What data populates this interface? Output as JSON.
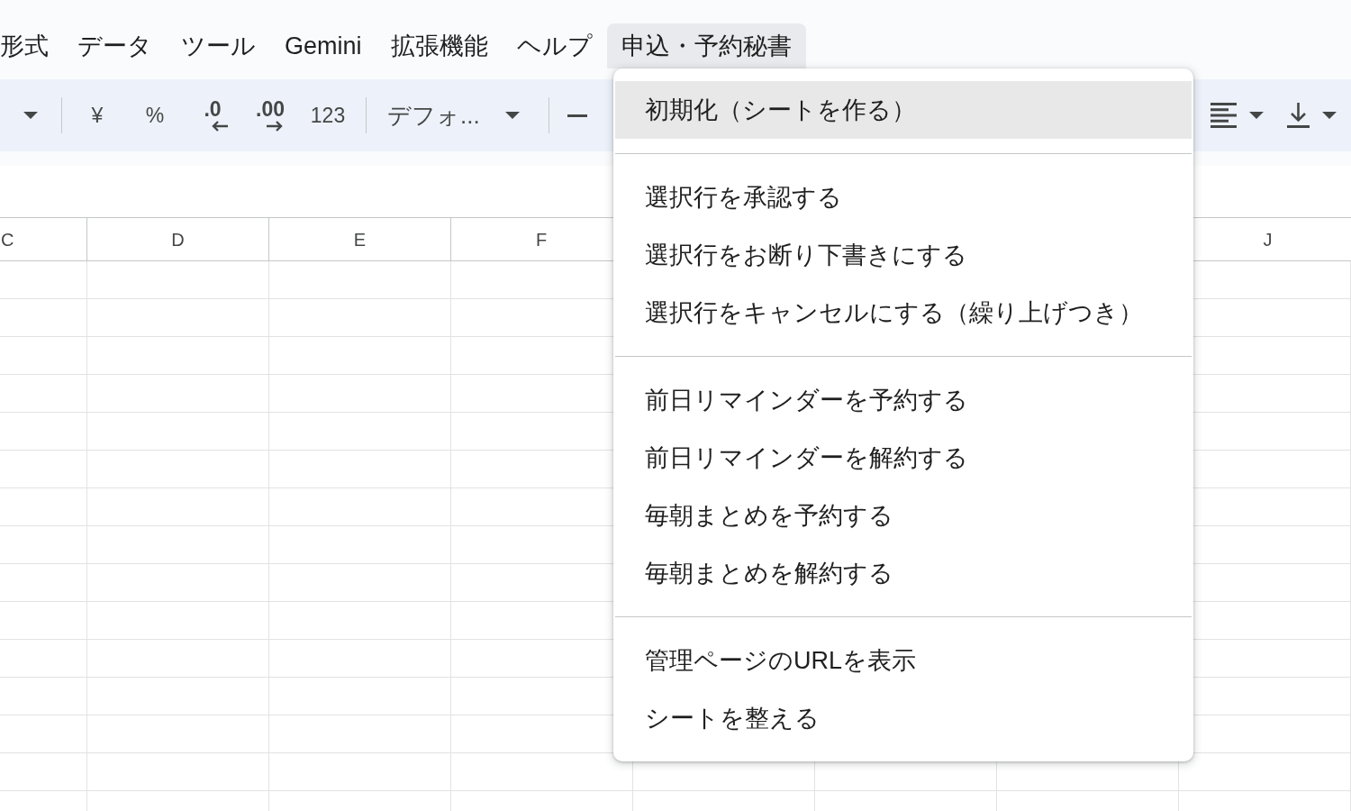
{
  "menu_bar": {
    "items": [
      {
        "label": "形式",
        "selected": false
      },
      {
        "label": "データ",
        "selected": false
      },
      {
        "label": "ツール",
        "selected": false
      },
      {
        "label": "Gemini",
        "selected": false
      },
      {
        "label": "拡張機能",
        "selected": false
      },
      {
        "label": "ヘルプ",
        "selected": false
      },
      {
        "label": "申込・予約秘書",
        "selected": true
      }
    ]
  },
  "toolbar": {
    "format_buttons": [
      {
        "kind": "currency",
        "label": "¥"
      },
      {
        "kind": "percent",
        "label": "%"
      },
      {
        "kind": "decimal_decrease",
        "label": ".0"
      },
      {
        "kind": "decimal_increase",
        "label": ".00"
      },
      {
        "kind": "number_format",
        "label": "123"
      }
    ],
    "font_dropdown": {
      "value": "デフォ..."
    }
  },
  "column_headers_left": [
    "C",
    "D",
    "E",
    "F"
  ],
  "column_headers_right": [
    "J"
  ],
  "dropdown_menu": {
    "groups": [
      {
        "items": [
          {
            "label": "初期化（シートを作る）",
            "selected": true
          }
        ]
      },
      {
        "items": [
          {
            "label": "選択行を承認する",
            "selected": false
          },
          {
            "label": "選択行をお断り下書きにする",
            "selected": false
          },
          {
            "label": "選択行をキャンセルにする（繰り上げつき）",
            "selected": false
          }
        ]
      },
      {
        "items": [
          {
            "label": "前日リマインダーを予約する",
            "selected": false
          },
          {
            "label": "前日リマインダーを解約する",
            "selected": false
          },
          {
            "label": "毎朝まとめを予約する",
            "selected": false
          },
          {
            "label": "毎朝まとめを解約する",
            "selected": false
          }
        ]
      },
      {
        "items": [
          {
            "label": "管理ページのURLを表示",
            "selected": false
          },
          {
            "label": "シートを整える",
            "selected": false
          }
        ]
      }
    ]
  }
}
